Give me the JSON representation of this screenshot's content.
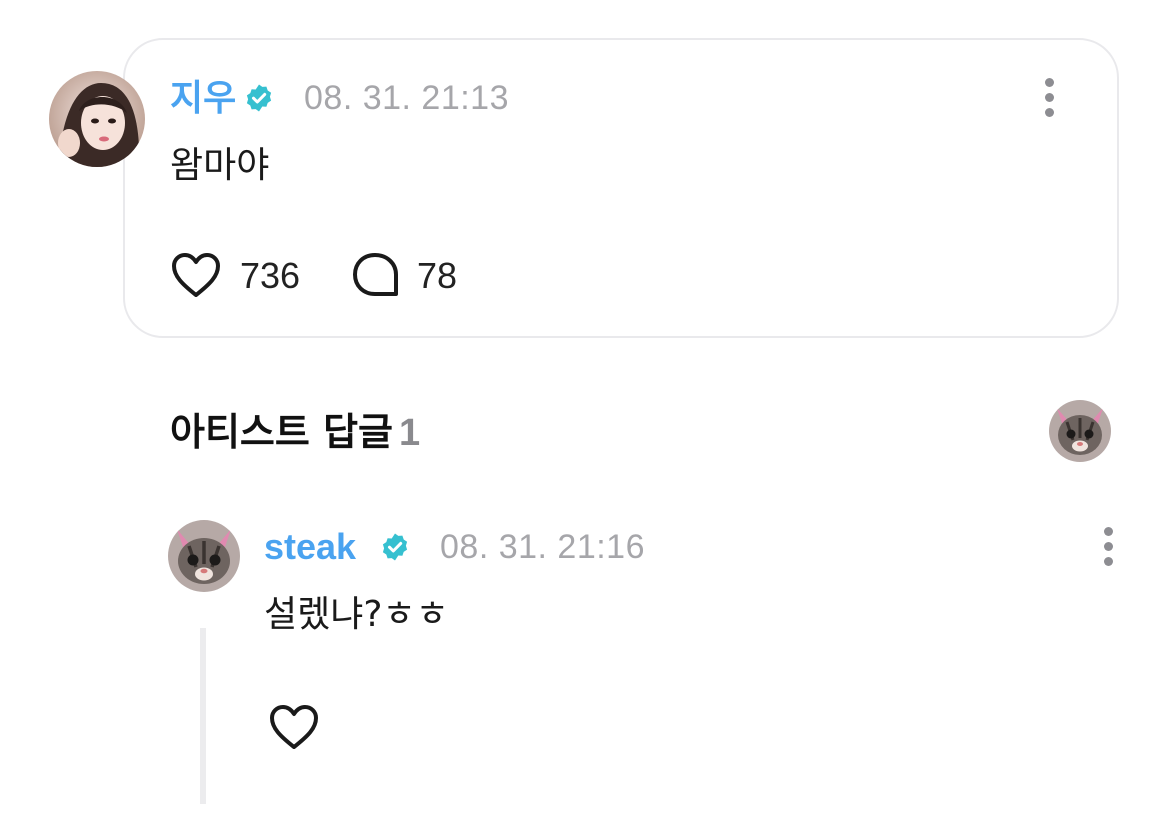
{
  "post": {
    "author": "지우",
    "timestamp": "08. 31. 21:13",
    "text": "왐마야",
    "likes": "736",
    "comments": "78",
    "icons": {
      "avatar": "profile-photo",
      "verified": "verified-badge-icon",
      "more": "more-vertical-icon",
      "like": "heart-outline-icon",
      "comment": "speech-bubble-outline-icon"
    }
  },
  "artist_replies": {
    "title": "아티스트 답글",
    "count": "1"
  },
  "reply": {
    "author": "steak",
    "timestamp": "08. 31. 21:16",
    "text": "설렜냐?ㅎㅎ",
    "icons": {
      "avatar": "cat-avatar",
      "verified": "verified-badge-icon",
      "more": "more-vertical-icon",
      "like": "heart-outline-icon"
    }
  },
  "colors": {
    "name": "#4aa3f0",
    "verified": "#36c0d0",
    "timestamp": "#a6a6aa",
    "card_border": "#e9e9ec"
  }
}
